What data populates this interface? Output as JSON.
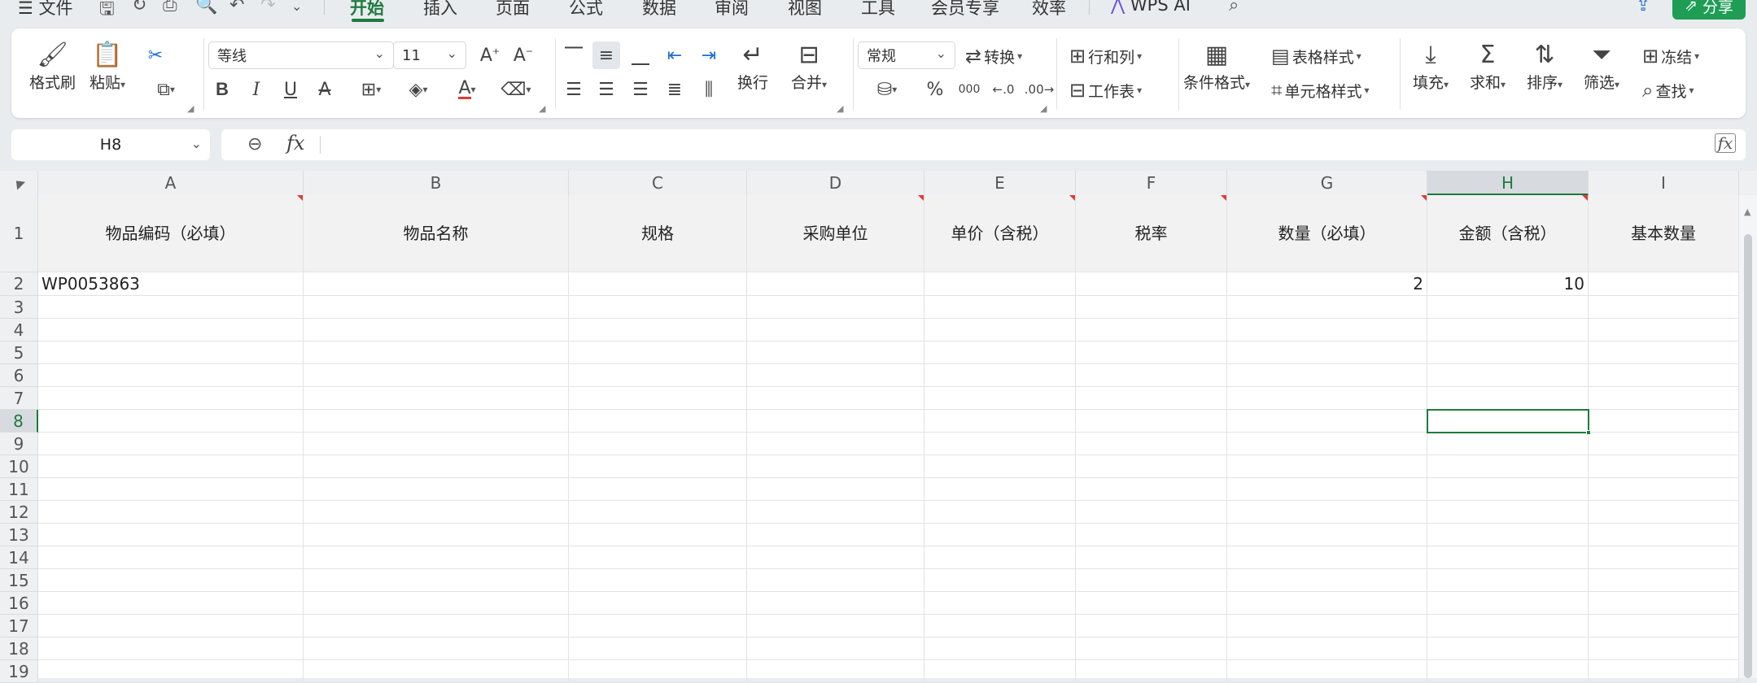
{
  "menu": {
    "file": "文件",
    "tabs": [
      {
        "label": "开始",
        "active": true
      },
      {
        "label": "插入",
        "active": false
      },
      {
        "label": "页面",
        "active": false
      },
      {
        "label": "公式",
        "active": false
      },
      {
        "label": "数据",
        "active": false
      },
      {
        "label": "审阅",
        "active": false
      },
      {
        "label": "视图",
        "active": false
      },
      {
        "label": "工具",
        "active": false
      },
      {
        "label": "会员专享",
        "active": false
      },
      {
        "label": "效率",
        "active": false
      }
    ],
    "wps_ai": "WPS AI",
    "share": "分享"
  },
  "ribbon": {
    "format_painter": "格式刷",
    "paste": "粘贴",
    "font_name": "等线",
    "font_size": "11",
    "bold": "B",
    "italic": "I",
    "underline": "U",
    "strike": "A",
    "font_color_letter": "A",
    "wrap": "换行",
    "merge": "合并",
    "number_format": "常规",
    "convert": "转换",
    "percent": "%",
    "thousands": "000",
    "row_col": "行和列",
    "worksheet": "工作表",
    "cond_format": "条件格式",
    "table_style": "表格样式",
    "cell_style": "单元格样式",
    "fill": "填充",
    "sum": "求和",
    "sort": "排序",
    "filter": "筛选",
    "freeze": "冻结",
    "find": "查找"
  },
  "namebox": "H8",
  "formula": "",
  "columns": [
    "A",
    "B",
    "C",
    "D",
    "E",
    "F",
    "G",
    "H",
    "I"
  ],
  "selected_column": "H",
  "selected_row": "8",
  "rows": [
    "1",
    "2",
    "3",
    "4",
    "5",
    "6",
    "7",
    "8",
    "9",
    "10",
    "11",
    "12",
    "13",
    "14",
    "15",
    "16",
    "17",
    "18",
    "19"
  ],
  "header_row": [
    "物品编码（必填）",
    "物品名称",
    "规格",
    "采购单位",
    "单价（含税）",
    "税率",
    "数量（必填）",
    "金额（含税）",
    "基本数量"
  ],
  "data_row_2": {
    "A": "WP0053863",
    "G": "2",
    "H": "10"
  },
  "colors": {
    "accent": "#1f7a3d",
    "share": "#1f9d55",
    "comment_marker": "#e53935"
  }
}
